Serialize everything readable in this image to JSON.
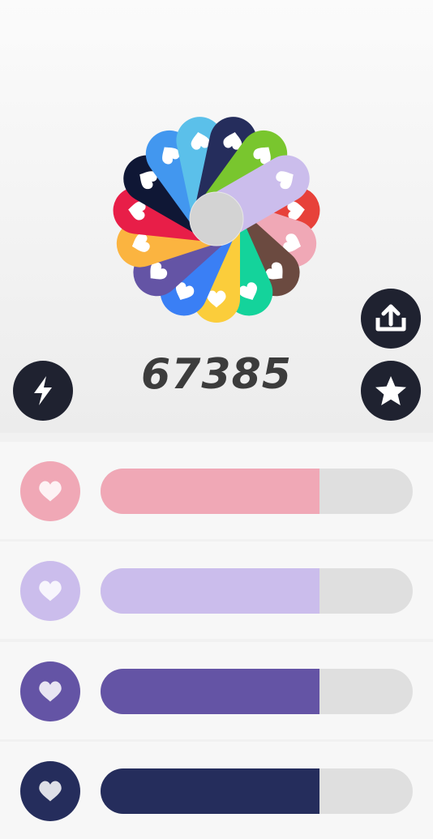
{
  "score": "67385",
  "wheel": {
    "petals": [
      {
        "name": "red",
        "color": "#e7413a"
      },
      {
        "name": "pink",
        "color": "#f0a8b6"
      },
      {
        "name": "brown",
        "color": "#6b4a40"
      },
      {
        "name": "green",
        "color": "#14d39b"
      },
      {
        "name": "yellow",
        "color": "#fbcd3b"
      },
      {
        "name": "blue",
        "color": "#3a7ff5"
      },
      {
        "name": "purple",
        "color": "#6454a5"
      },
      {
        "name": "orange",
        "color": "#fbb440"
      },
      {
        "name": "crimson",
        "color": "#e81e48"
      },
      {
        "name": "navy-black",
        "color": "#0f1735"
      },
      {
        "name": "blue-light",
        "color": "#4297ef"
      },
      {
        "name": "sky",
        "color": "#5bc0ea"
      },
      {
        "name": "dark-navy",
        "color": "#252d5c"
      },
      {
        "name": "lime",
        "color": "#79c62e"
      },
      {
        "name": "lavender",
        "color": "#cbbdec"
      }
    ],
    "center_color": "#d3d3d3",
    "selected": "lavender"
  },
  "buttons": {
    "share_icon": "share-upload-icon",
    "boost_icon": "lightning-icon",
    "favorite_icon": "star-icon",
    "color": "#1f2230"
  },
  "rows": [
    {
      "name": "pink",
      "color": "#f0a8b6",
      "progress": 0.7
    },
    {
      "name": "lavender",
      "color": "#cbbdec",
      "progress": 0.7
    },
    {
      "name": "purple",
      "color": "#6454a5",
      "progress": 0.7
    },
    {
      "name": "dark-navy",
      "color": "#252d5c",
      "progress": 0.7
    }
  ]
}
